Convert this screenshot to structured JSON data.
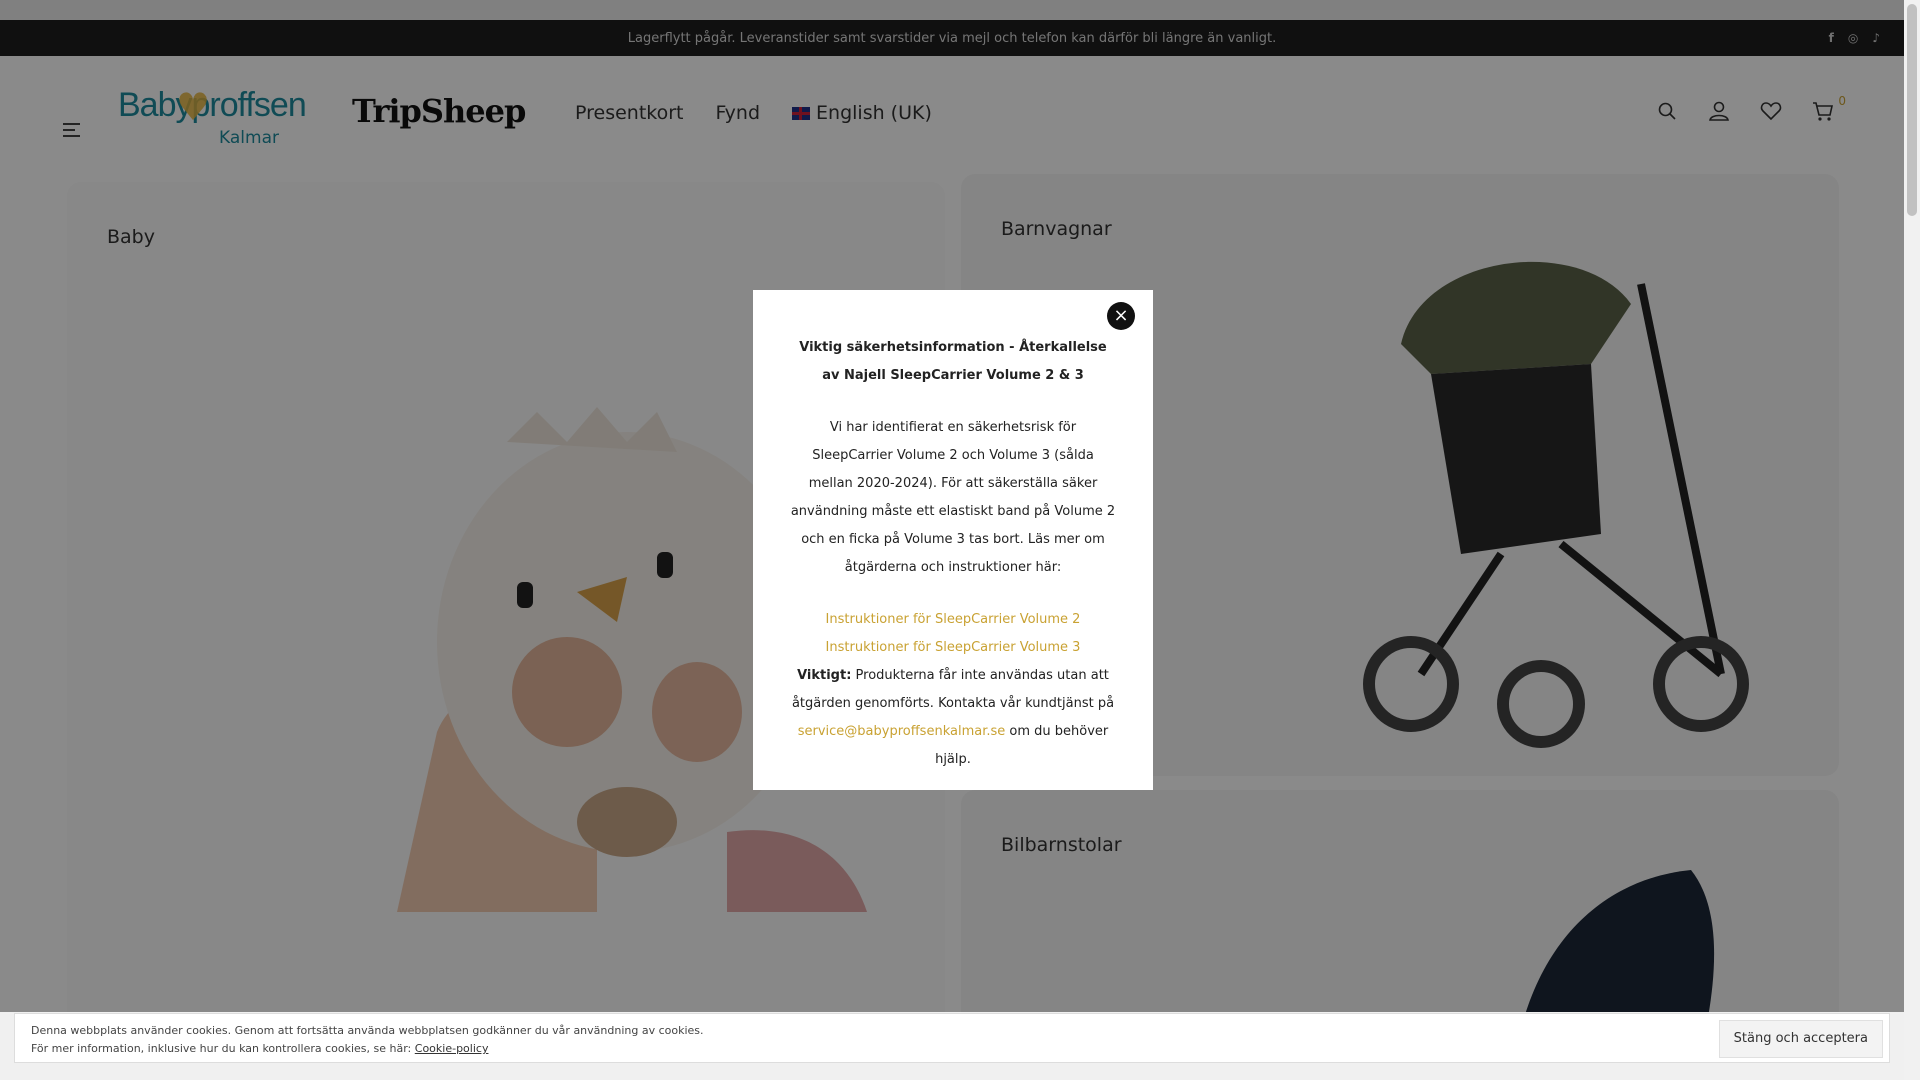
{
  "announcement": {
    "text": "Lagerflytt pågår. Leveranstider samt svarstider via mejl och telefon kan därför bli längre än vanligt.",
    "social": [
      "f",
      "◎",
      "♪"
    ]
  },
  "header": {
    "logo_brand": "Babyproffsen",
    "logo_sub": "Kalmar",
    "logo2": "TripSheep",
    "nav": [
      "Presentkort",
      "Fynd",
      "English (UK)"
    ],
    "cart_count": "0"
  },
  "categories": {
    "baby": "Baby",
    "barnvagnar": "Barnvagnar",
    "bilbarnstolar": "Bilbarnstolar"
  },
  "modal": {
    "close": "×",
    "title": "Viktig säkerhetsinformation - Återkallelse av Najell SleepCarrier Volume 2 & 3",
    "body": "Vi har identifierat en säkerhetsrisk för SleepCarrier Volume 2 och Volume 3 (sålda mellan 2020-2024). För att säkerställa säker användning måste ett elastiskt band på Volume 2 och en ficka på Volume 3 tas bort. Läs mer om åtgärderna och instruktioner här:",
    "link1": "Instruktioner för SleepCarrier Volume 2",
    "link2": "Instruktioner för SleepCarrier Volume 3",
    "important_label": "Viktigt:",
    "important_text": " Produkterna får inte användas utan att åtgärden genomförts. Kontakta vår kundtjänst på ",
    "email": "service@babyproffsenkalmar.se",
    "tail": " om du behöver hjälp."
  },
  "cookie": {
    "line1": "Denna webbplats använder cookies. Genom att fortsätta använda webbplatsen godkänner du vår användning av cookies.",
    "line2": "För mer information, inklusive hur du kan kontrollera cookies, se här: ",
    "policy_link": "Cookie-policy",
    "accept": "Stäng och acceptera"
  },
  "colors": {
    "accent": "#c9a233",
    "brand": "#1f8b9e"
  }
}
